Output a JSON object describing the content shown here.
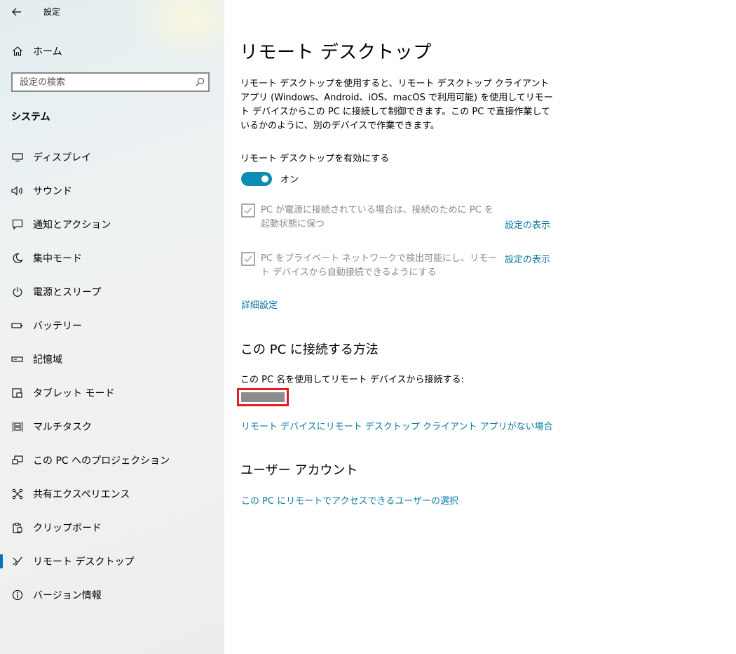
{
  "window": {
    "title": "設定"
  },
  "sidebar": {
    "home": "ホーム",
    "search_placeholder": "設定の検索",
    "section_title": "システム",
    "items": [
      {
        "label": "ディスプレイ",
        "icon": "display-icon"
      },
      {
        "label": "サウンド",
        "icon": "sound-icon"
      },
      {
        "label": "通知とアクション",
        "icon": "notification-icon"
      },
      {
        "label": "集中モード",
        "icon": "moon-icon"
      },
      {
        "label": "電源とスリープ",
        "icon": "power-icon"
      },
      {
        "label": "バッテリー",
        "icon": "battery-icon"
      },
      {
        "label": "記憶域",
        "icon": "storage-icon"
      },
      {
        "label": "タブレット モード",
        "icon": "tablet-icon"
      },
      {
        "label": "マルチタスク",
        "icon": "multitask-icon"
      },
      {
        "label": "この PC へのプロジェクション",
        "icon": "projection-icon"
      },
      {
        "label": "共有エクスペリエンス",
        "icon": "shared-experience-icon"
      },
      {
        "label": "クリップボード",
        "icon": "clipboard-icon"
      },
      {
        "label": "リモート デスクトップ",
        "icon": "remote-desktop-icon",
        "active": true
      },
      {
        "label": "バージョン情報",
        "icon": "info-icon"
      }
    ]
  },
  "main": {
    "title": "リモート デスクトップ",
    "description": "リモート デスクトップを使用すると、リモート デスクトップ クライアント アプリ (Windows、Android、iOS、macOS で利用可能) を使用してリモート デバイスからこの PC に接続して制御できます。この PC で直接作業しているかのように、別のデバイスで作業できます。",
    "toggle_label": "リモート デスクトップを有効にする",
    "toggle_state": "オン",
    "option1": {
      "text": "PC が電源に接続されている場合は、接続のために PC を起動状態に保つ",
      "link": "設定の表示",
      "checked": true
    },
    "option2": {
      "text": "PC をプライベート ネットワークで検出可能にし、リモート デバイスから自動接続できるようにする",
      "link": "設定の表示",
      "checked": true
    },
    "advanced_link": "詳細設定",
    "connect_heading": "この PC に接続する方法",
    "connect_text": "この PC 名を使用してリモート デバイスから接続する:",
    "no_client_link": "リモート デバイスにリモート デスクトップ クライアント アプリがない場合",
    "account_heading": "ユーザー アカウント",
    "account_link": "この PC にリモートでアクセスできるユーザーの選択"
  },
  "colors": {
    "accent": "#0f8ab0",
    "link": "#0a7aa4",
    "highlight_border": "#e31b23"
  }
}
